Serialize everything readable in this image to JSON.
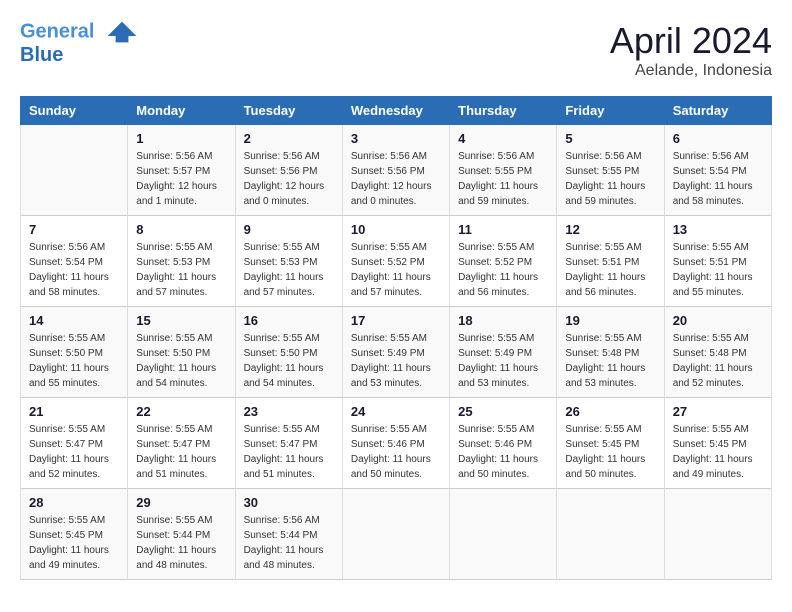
{
  "header": {
    "logo_line1": "General",
    "logo_line2": "Blue",
    "month": "April 2024",
    "location": "Aelande, Indonesia"
  },
  "days_of_week": [
    "Sunday",
    "Monday",
    "Tuesday",
    "Wednesday",
    "Thursday",
    "Friday",
    "Saturday"
  ],
  "weeks": [
    [
      {
        "day": "",
        "sunrise": "",
        "sunset": "",
        "daylight": ""
      },
      {
        "day": "1",
        "sunrise": "Sunrise: 5:56 AM",
        "sunset": "Sunset: 5:57 PM",
        "daylight": "Daylight: 12 hours and 1 minute."
      },
      {
        "day": "2",
        "sunrise": "Sunrise: 5:56 AM",
        "sunset": "Sunset: 5:56 PM",
        "daylight": "Daylight: 12 hours and 0 minutes."
      },
      {
        "day": "3",
        "sunrise": "Sunrise: 5:56 AM",
        "sunset": "Sunset: 5:56 PM",
        "daylight": "Daylight: 12 hours and 0 minutes."
      },
      {
        "day": "4",
        "sunrise": "Sunrise: 5:56 AM",
        "sunset": "Sunset: 5:55 PM",
        "daylight": "Daylight: 11 hours and 59 minutes."
      },
      {
        "day": "5",
        "sunrise": "Sunrise: 5:56 AM",
        "sunset": "Sunset: 5:55 PM",
        "daylight": "Daylight: 11 hours and 59 minutes."
      },
      {
        "day": "6",
        "sunrise": "Sunrise: 5:56 AM",
        "sunset": "Sunset: 5:54 PM",
        "daylight": "Daylight: 11 hours and 58 minutes."
      }
    ],
    [
      {
        "day": "7",
        "sunrise": "Sunrise: 5:56 AM",
        "sunset": "Sunset: 5:54 PM",
        "daylight": "Daylight: 11 hours and 58 minutes."
      },
      {
        "day": "8",
        "sunrise": "Sunrise: 5:55 AM",
        "sunset": "Sunset: 5:53 PM",
        "daylight": "Daylight: 11 hours and 57 minutes."
      },
      {
        "day": "9",
        "sunrise": "Sunrise: 5:55 AM",
        "sunset": "Sunset: 5:53 PM",
        "daylight": "Daylight: 11 hours and 57 minutes."
      },
      {
        "day": "10",
        "sunrise": "Sunrise: 5:55 AM",
        "sunset": "Sunset: 5:52 PM",
        "daylight": "Daylight: 11 hours and 57 minutes."
      },
      {
        "day": "11",
        "sunrise": "Sunrise: 5:55 AM",
        "sunset": "Sunset: 5:52 PM",
        "daylight": "Daylight: 11 hours and 56 minutes."
      },
      {
        "day": "12",
        "sunrise": "Sunrise: 5:55 AM",
        "sunset": "Sunset: 5:51 PM",
        "daylight": "Daylight: 11 hours and 56 minutes."
      },
      {
        "day": "13",
        "sunrise": "Sunrise: 5:55 AM",
        "sunset": "Sunset: 5:51 PM",
        "daylight": "Daylight: 11 hours and 55 minutes."
      }
    ],
    [
      {
        "day": "14",
        "sunrise": "Sunrise: 5:55 AM",
        "sunset": "Sunset: 5:50 PM",
        "daylight": "Daylight: 11 hours and 55 minutes."
      },
      {
        "day": "15",
        "sunrise": "Sunrise: 5:55 AM",
        "sunset": "Sunset: 5:50 PM",
        "daylight": "Daylight: 11 hours and 54 minutes."
      },
      {
        "day": "16",
        "sunrise": "Sunrise: 5:55 AM",
        "sunset": "Sunset: 5:50 PM",
        "daylight": "Daylight: 11 hours and 54 minutes."
      },
      {
        "day": "17",
        "sunrise": "Sunrise: 5:55 AM",
        "sunset": "Sunset: 5:49 PM",
        "daylight": "Daylight: 11 hours and 53 minutes."
      },
      {
        "day": "18",
        "sunrise": "Sunrise: 5:55 AM",
        "sunset": "Sunset: 5:49 PM",
        "daylight": "Daylight: 11 hours and 53 minutes."
      },
      {
        "day": "19",
        "sunrise": "Sunrise: 5:55 AM",
        "sunset": "Sunset: 5:48 PM",
        "daylight": "Daylight: 11 hours and 53 minutes."
      },
      {
        "day": "20",
        "sunrise": "Sunrise: 5:55 AM",
        "sunset": "Sunset: 5:48 PM",
        "daylight": "Daylight: 11 hours and 52 minutes."
      }
    ],
    [
      {
        "day": "21",
        "sunrise": "Sunrise: 5:55 AM",
        "sunset": "Sunset: 5:47 PM",
        "daylight": "Daylight: 11 hours and 52 minutes."
      },
      {
        "day": "22",
        "sunrise": "Sunrise: 5:55 AM",
        "sunset": "Sunset: 5:47 PM",
        "daylight": "Daylight: 11 hours and 51 minutes."
      },
      {
        "day": "23",
        "sunrise": "Sunrise: 5:55 AM",
        "sunset": "Sunset: 5:47 PM",
        "daylight": "Daylight: 11 hours and 51 minutes."
      },
      {
        "day": "24",
        "sunrise": "Sunrise: 5:55 AM",
        "sunset": "Sunset: 5:46 PM",
        "daylight": "Daylight: 11 hours and 50 minutes."
      },
      {
        "day": "25",
        "sunrise": "Sunrise: 5:55 AM",
        "sunset": "Sunset: 5:46 PM",
        "daylight": "Daylight: 11 hours and 50 minutes."
      },
      {
        "day": "26",
        "sunrise": "Sunrise: 5:55 AM",
        "sunset": "Sunset: 5:45 PM",
        "daylight": "Daylight: 11 hours and 50 minutes."
      },
      {
        "day": "27",
        "sunrise": "Sunrise: 5:55 AM",
        "sunset": "Sunset: 5:45 PM",
        "daylight": "Daylight: 11 hours and 49 minutes."
      }
    ],
    [
      {
        "day": "28",
        "sunrise": "Sunrise: 5:55 AM",
        "sunset": "Sunset: 5:45 PM",
        "daylight": "Daylight: 11 hours and 49 minutes."
      },
      {
        "day": "29",
        "sunrise": "Sunrise: 5:55 AM",
        "sunset": "Sunset: 5:44 PM",
        "daylight": "Daylight: 11 hours and 48 minutes."
      },
      {
        "day": "30",
        "sunrise": "Sunrise: 5:56 AM",
        "sunset": "Sunset: 5:44 PM",
        "daylight": "Daylight: 11 hours and 48 minutes."
      },
      {
        "day": "",
        "sunrise": "",
        "sunset": "",
        "daylight": ""
      },
      {
        "day": "",
        "sunrise": "",
        "sunset": "",
        "daylight": ""
      },
      {
        "day": "",
        "sunrise": "",
        "sunset": "",
        "daylight": ""
      },
      {
        "day": "",
        "sunrise": "",
        "sunset": "",
        "daylight": ""
      }
    ]
  ]
}
